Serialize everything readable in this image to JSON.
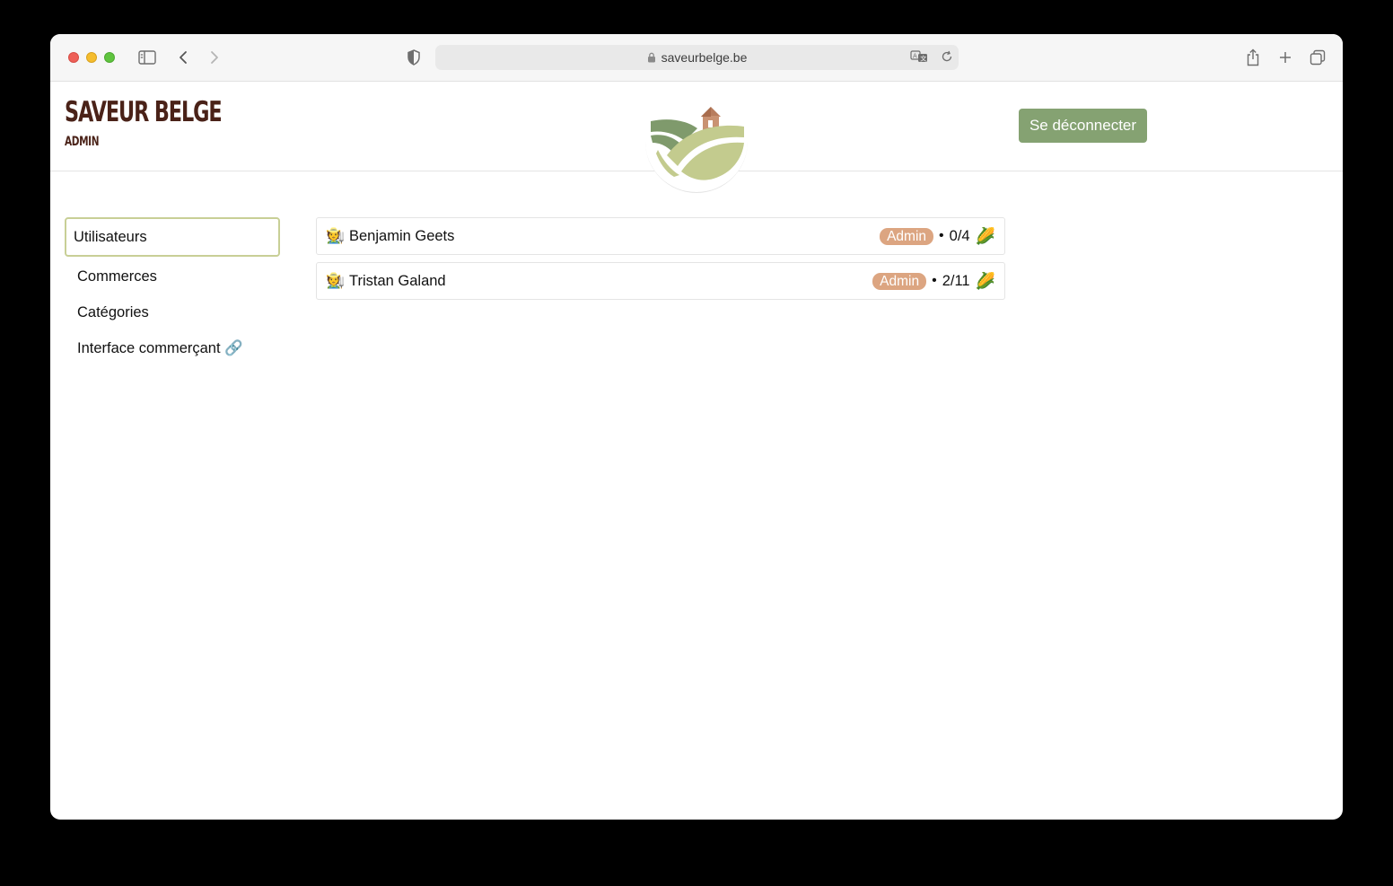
{
  "browser": {
    "url": "saveurbelge.be",
    "icons": [
      "sidebar-toggle-icon",
      "back-icon",
      "forward-icon",
      "shield-icon",
      "lock-icon",
      "translate-icon",
      "reload-icon",
      "share-icon",
      "new-tab-icon",
      "tabs-overview-icon"
    ]
  },
  "header": {
    "title": "Saveur Belge",
    "subtitle": "Admin",
    "logout_label": "Se déconnecter"
  },
  "sidebar": {
    "items": [
      {
        "label": "Utilisateurs",
        "active": true
      },
      {
        "label": "Commerces",
        "active": false
      },
      {
        "label": "Catégories",
        "active": false
      },
      {
        "label": "Interface commerçant 🔗",
        "active": false
      }
    ]
  },
  "users": [
    {
      "emoji": "🧑‍🌾",
      "name": "Benjamin Geets",
      "role": "Admin",
      "separator": "•",
      "count": "0/4",
      "count_icon": "🌽"
    },
    {
      "emoji": "🧑‍🌾",
      "name": "Tristan Galand",
      "role": "Admin",
      "separator": "•",
      "count": "2/11",
      "count_icon": "🌽"
    }
  ],
  "colors": {
    "brand": "#4a2218",
    "accent": "#85a272",
    "badge": "#dca581",
    "active_border": "#c8cf96"
  }
}
